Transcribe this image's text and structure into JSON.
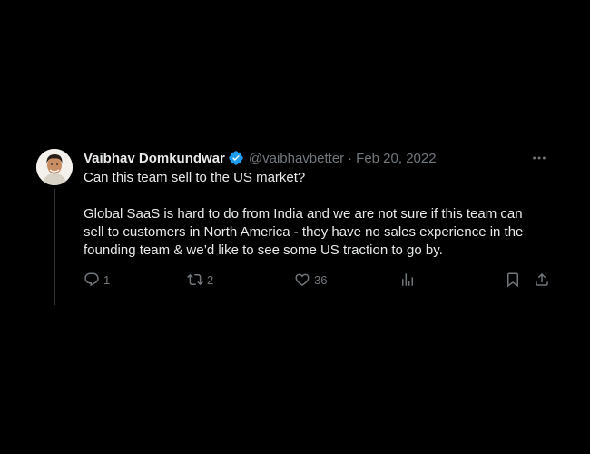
{
  "tweet": {
    "display_name": "Vaibhav Domkundwar",
    "handle": "@vaibhavbetter",
    "separator": "·",
    "date": "Feb 20, 2022",
    "text_line1": "Can this team sell to the US market?",
    "text_para2": "Global SaaS is hard to do from India and we are not sure if this team can sell to customers in North America - they have no sales experience in the founding team & we’d like to see some US traction to go by.",
    "verified_color": "#1d9bf0",
    "avatar": "avatar-photo"
  },
  "actions": {
    "reply_count": "1",
    "retweet_count": "2",
    "like_count": "36",
    "icons": [
      "reply-icon",
      "retweet-icon",
      "like-icon",
      "views-icon",
      "bookmark-icon",
      "share-icon"
    ]
  },
  "colors": {
    "background": "#000000",
    "text": "#e7e9ea",
    "muted": "#71767b"
  }
}
